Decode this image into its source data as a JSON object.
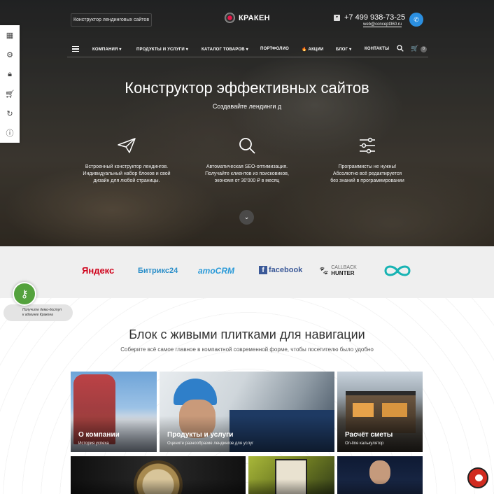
{
  "header": {
    "tagline": "Конструктор лендинговых сайтов",
    "logo_text": "КРАКЕН",
    "phone": "+7 499 938-73-25",
    "email": "web@concept360.ru"
  },
  "nav": {
    "items": [
      "КОМПАНИЯ ▾",
      "ПРОДУКТЫ И УСЛУГИ ▾",
      "КАТАЛОГ ТОВАРОВ ▾",
      "ПОРТФОЛИО",
      "🔥 АКЦИИ",
      "БЛОГ ▾",
      "КОНТАКТЫ"
    ],
    "cart_count": "0"
  },
  "hero": {
    "title": "Конструктор эффективных сайтов",
    "subtitle": "Создавайте лендинги д",
    "features": [
      {
        "icon": "paper-plane-icon",
        "line1": "Встроенный конструктор лендингов.",
        "line2": "Индивидуальный набор блоков и свой",
        "line3": "дизайн для любой страницы."
      },
      {
        "icon": "search-icon",
        "line1": "Автоматическая SEO-оптимизация.",
        "line2": "Получайте клиентов из поисковиков,",
        "line3": "экономя от 30'000 ₽ в месяц"
      },
      {
        "icon": "sliders-icon",
        "line1": "Программисты не нужны!",
        "line2": "Абсолютно всё редактируется",
        "line3": "без знаний в программировании"
      }
    ]
  },
  "partners": {
    "yandex": "Яндекс",
    "bitrix": "Битрикс24",
    "amocrm": "amoCRM",
    "facebook": "facebook",
    "callback_top": "CALLBACK",
    "callback_bottom": "HUNTER"
  },
  "demo": {
    "line1": "Получите демо-доступ",
    "line2": "к админке Кракена"
  },
  "section": {
    "title": "Блок с живыми плитками для навигации",
    "subtitle": "Соберите всё самое главное в компактной современной форме, чтобы посетителю было удобно"
  },
  "tiles": [
    {
      "title": "О компании",
      "subtitle": "История успеха"
    },
    {
      "title": "Продукты и услуги",
      "subtitle": "Оцените разнообразие лендингов для услуг"
    },
    {
      "title": "Расчёт сметы",
      "subtitle": "On-line калькулятор"
    }
  ],
  "colors": {
    "accent": "#2b8fe0",
    "demo_green": "#54a23d",
    "chat_red": "#d12b20",
    "partners_bg": "#efefef"
  }
}
